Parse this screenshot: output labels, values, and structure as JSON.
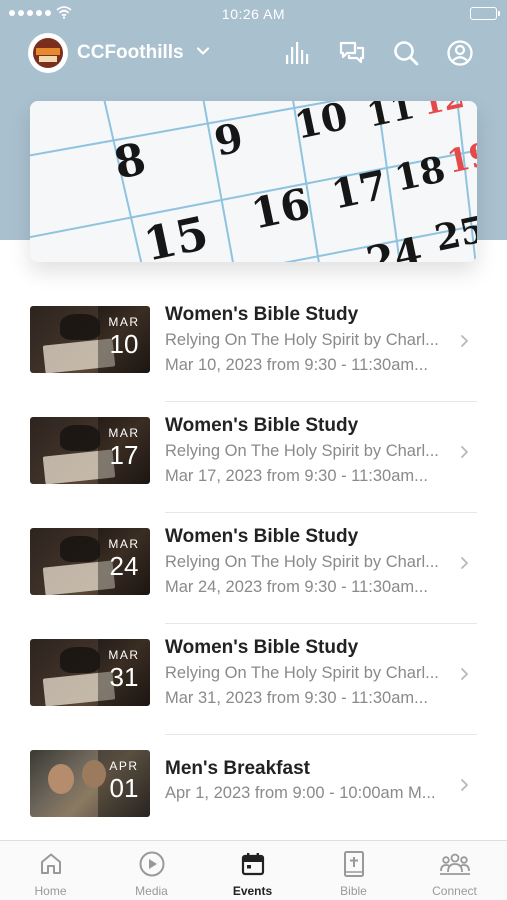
{
  "status_bar": {
    "time": "10:26 AM"
  },
  "header": {
    "org_name": "CCFoothills",
    "icons": [
      "bar-chart-icon",
      "chat-bubbles-icon",
      "search-icon",
      "profile-icon"
    ]
  },
  "events": [
    {
      "month": "MAR",
      "day": "10",
      "title": "Women's Bible Study",
      "line1": "Relying On The Holy Spirit by Charl...",
      "line2": "Mar 10, 2023 from 9:30 - 11:30am..."
    },
    {
      "month": "MAR",
      "day": "17",
      "title": "Women's Bible Study",
      "line1": "Relying On The Holy Spirit by Charl...",
      "line2": "Mar 17, 2023 from 9:30 - 11:30am..."
    },
    {
      "month": "MAR",
      "day": "24",
      "title": "Women's Bible Study",
      "line1": "Relying On The Holy Spirit by Charl...",
      "line2": "Mar 24, 2023 from 9:30 - 11:30am..."
    },
    {
      "month": "MAR",
      "day": "31",
      "title": "Women's Bible Study",
      "line1": "Relying On The Holy Spirit by Charl...",
      "line2": "Mar 31, 2023 from 9:30 - 11:30am..."
    },
    {
      "month": "APR",
      "day": "01",
      "title": "Men's Breakfast",
      "line1": "Apr 1, 2023 from 9:00 - 10:00am M..."
    }
  ],
  "tabs": [
    {
      "label": "Home",
      "icon": "home-icon",
      "active": false
    },
    {
      "label": "Media",
      "icon": "play-circle-icon",
      "active": false
    },
    {
      "label": "Events",
      "icon": "calendar-icon",
      "active": true
    },
    {
      "label": "Bible",
      "icon": "bible-icon",
      "active": false
    },
    {
      "label": "Connect",
      "icon": "people-icon",
      "active": false
    }
  ],
  "colors": {
    "header_background": "#a9c0cf",
    "active_tab": "#222222",
    "inactive_tab": "#999999",
    "secondary_text": "#8a8a8a"
  }
}
